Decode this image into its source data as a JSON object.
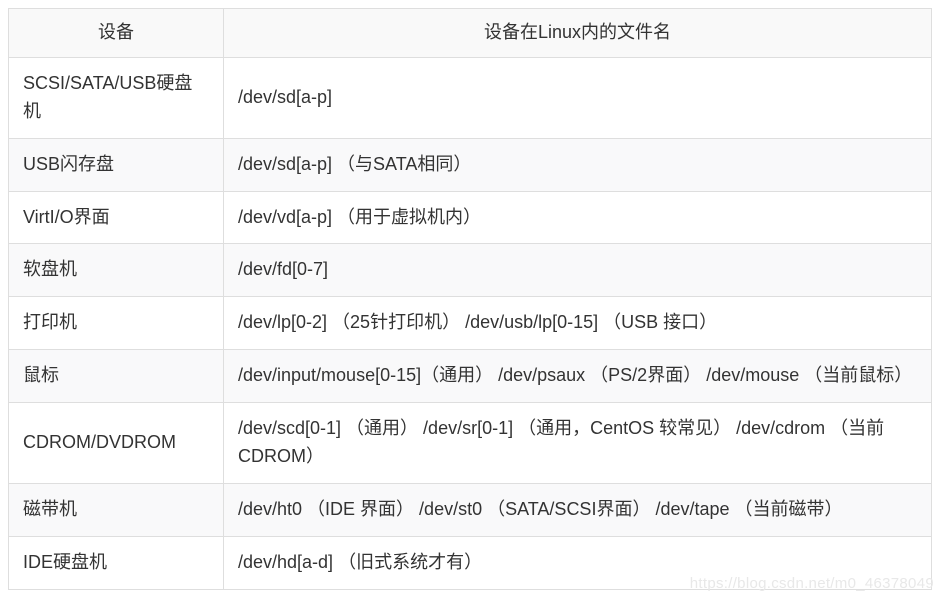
{
  "table": {
    "headers": {
      "device": "设备",
      "filename": "设备在Linux内的文件名"
    },
    "rows": [
      {
        "device": "SCSI/SATA/USB硬盘机",
        "filename": "/dev/sd[a-p]"
      },
      {
        "device": "USB闪存盘",
        "filename": "/dev/sd[a-p] （与SATA相同）"
      },
      {
        "device": "VirtI/O界面",
        "filename": "/dev/vd[a-p] （用于虚拟机内）"
      },
      {
        "device": "软盘机",
        "filename": "/dev/fd[0-7]"
      },
      {
        "device": "打印机",
        "filename": "/dev/lp[0-2] （25针打印机） /dev/usb/lp[0-15] （USB 接口）"
      },
      {
        "device": "鼠标",
        "filename": "/dev/input/mouse[0-15]（通用） /dev/psaux （PS/2界面） /dev/mouse （当前鼠标）"
      },
      {
        "device": "CDROM/DVDROM",
        "filename": "/dev/scd[0-1] （通用） /dev/sr[0-1] （通用，CentOS 较常见） /dev/cdrom （当前 CDROM）"
      },
      {
        "device": "磁带机",
        "filename": "/dev/ht0 （IDE 界面） /dev/st0 （SATA/SCSI界面） /dev/tape （当前磁带）"
      },
      {
        "device": "IDE硬盘机",
        "filename": "/dev/hd[a-d] （旧式系统才有）"
      }
    ]
  },
  "watermark": "https://blog.csdn.net/m0_46378049"
}
